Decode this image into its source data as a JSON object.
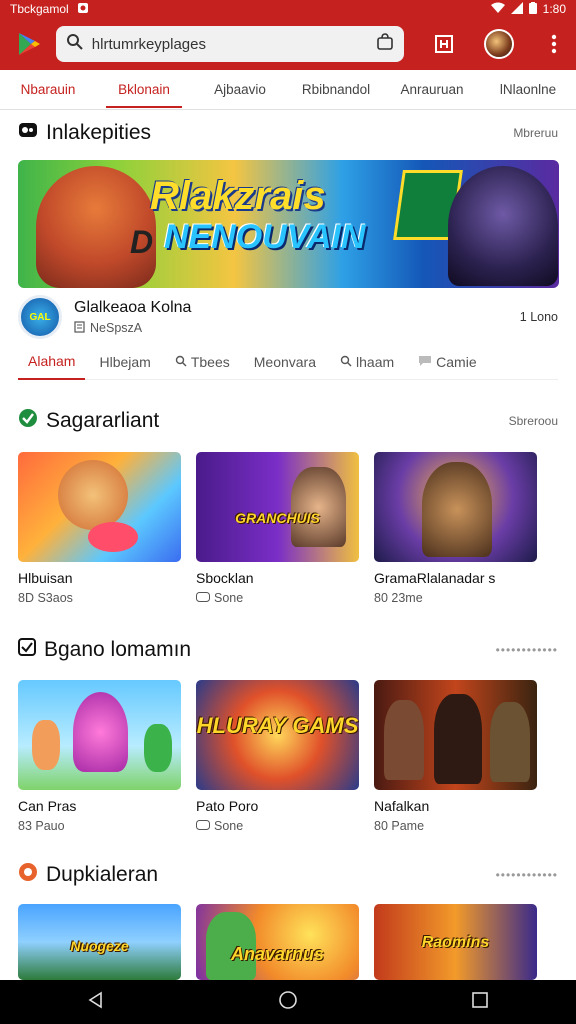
{
  "status": {
    "app_label": "Tbckgamol",
    "time": "1:80"
  },
  "appbar": {
    "search_value": "hlrtumrkeyplages",
    "icons": [
      "play-logo-icon",
      "search-icon",
      "bag-icon",
      "library-icon",
      "avatar",
      "more-vert-icon"
    ]
  },
  "tabs": [
    "Nbarauin",
    "Bklonain",
    "Ajbaavio",
    "Rbibnandol",
    "Anrauruan",
    "lNlaonlne"
  ],
  "featured": {
    "title": "Inlakepities",
    "more": "Mbreruu",
    "banner_line1": "Rlakzrais",
    "banner_line2": "NENOUVAIN",
    "banner_badge": "D",
    "channel_name": "Glalkeaoa Kolna",
    "channel_sub": "NeSpszA",
    "channel_right": "1 Lono",
    "channel_logo_text": "GAL"
  },
  "subtabs": [
    "Alaham",
    "Hlbejam",
    "Tbees",
    "Meonvara",
    "lhaam",
    "Camie"
  ],
  "sections": [
    {
      "title": "Sagararliant",
      "more": "Sbreroou",
      "cards": [
        {
          "title": "Hlbuisan",
          "sub": "8D S3aos",
          "thumb_text": ""
        },
        {
          "title": "Sbocklan",
          "sub": "Sone",
          "thumb_text": "GRANCHUIS"
        },
        {
          "title": "GramaRlalanadar s",
          "sub": "80 23me",
          "thumb_text": ""
        }
      ]
    },
    {
      "title": "Bgano lomamın",
      "more": "",
      "cards": [
        {
          "title": "Can Pras",
          "sub": "83 Pauo",
          "thumb_text": ""
        },
        {
          "title": "Pato Poro",
          "sub": "Sone",
          "thumb_text": "HLURAY GAMS"
        },
        {
          "title": "Nafalkan",
          "sub": "80 Pame",
          "thumb_text": ""
        }
      ]
    },
    {
      "title": "Dupkialeran",
      "more": "",
      "cards": [
        {
          "title": "",
          "sub": "",
          "thumb_text": "Nuogeze"
        },
        {
          "title": "",
          "sub": "",
          "thumb_text": "Anavarnus"
        },
        {
          "title": "",
          "sub": "",
          "thumb_text": "Raomins"
        }
      ]
    }
  ],
  "colors": {
    "accent": "#c5221f",
    "statusbar": "#c5221f"
  }
}
